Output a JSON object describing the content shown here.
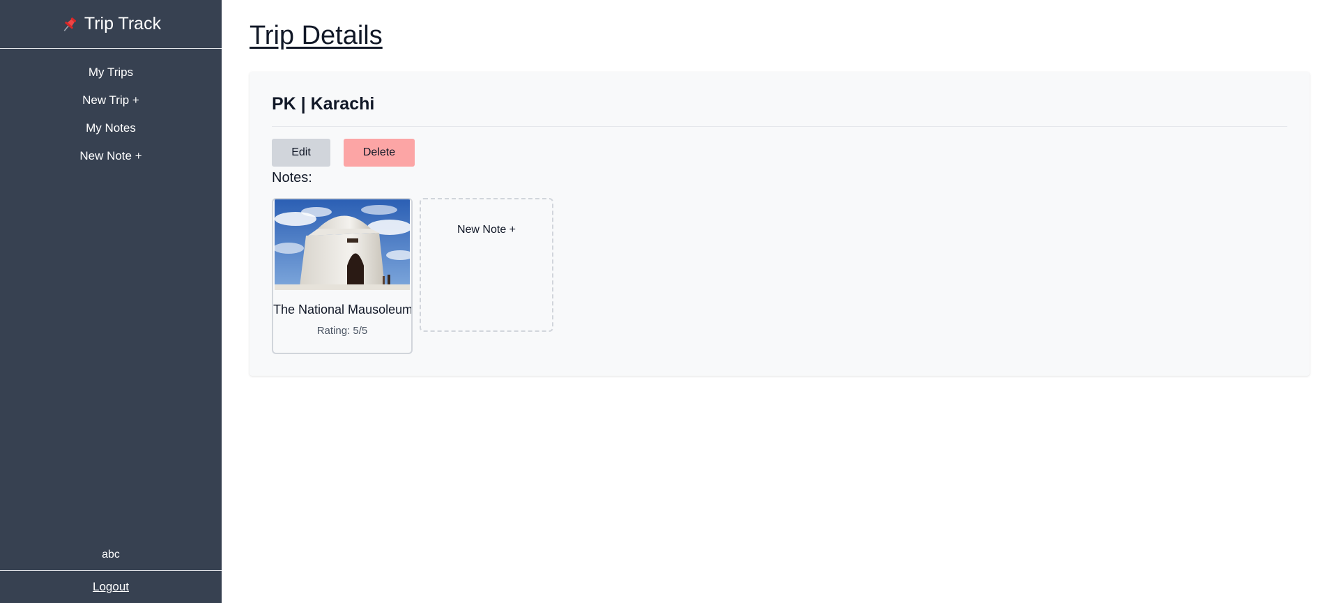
{
  "sidebar": {
    "brand_icon": "pushpin-icon",
    "brand_title": "Trip Track",
    "nav": [
      {
        "label": "My Trips"
      },
      {
        "label": "New Trip +"
      },
      {
        "label": "My Notes"
      },
      {
        "label": "New Note +"
      }
    ],
    "username": "abc",
    "logout_label": "Logout"
  },
  "main": {
    "page_title": "Trip Details",
    "trip": {
      "heading": "PK | Karachi",
      "edit_label": "Edit",
      "delete_label": "Delete"
    },
    "notes_label": "Notes:",
    "notes": [
      {
        "title": "The National Mausoleum",
        "rating": "Rating: 5/5"
      }
    ],
    "new_note_label": "New Note +"
  },
  "colors": {
    "sidebar_bg": "#374151",
    "delete_button": "#fca5a5",
    "edit_button": "#d1d5db",
    "panel_bg": "#f8f9fa"
  }
}
